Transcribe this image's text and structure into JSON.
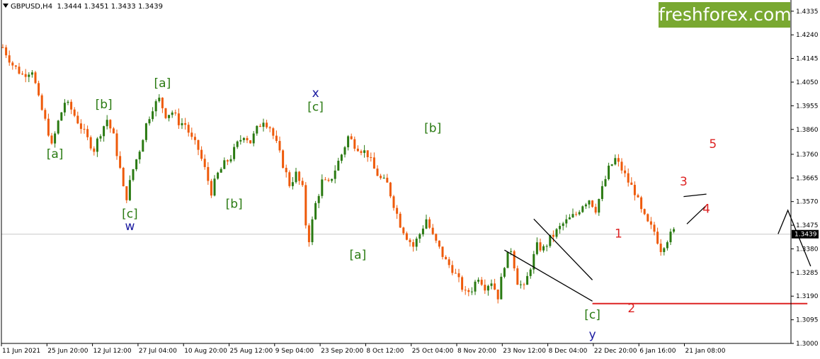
{
  "header": {
    "symbol": "GBPUSD,H4",
    "ohlc": "1.3444 1.3451 1.3433 1.3439"
  },
  "brand": {
    "logo_text": "freshforex.com"
  },
  "colors": {
    "bull": "#2a7a12",
    "bear": "#ee5a0a",
    "green_label": "#2a7a12",
    "blue_label": "#1a1aa0",
    "red_label": "#dd2222",
    "red_line": "#dd2222",
    "price_line": "#c8c8c8"
  },
  "chart_data": {
    "type": "candlestick",
    "ylim": [
      1.3,
      1.438
    ],
    "y_ticks": [
      "1.4335",
      "1.4240",
      "1.4145",
      "1.4050",
      "1.3955",
      "1.3860",
      "1.3760",
      "1.3665",
      "1.3570",
      "1.3475",
      "1.3380",
      "1.3285",
      "1.3190",
      "1.3095",
      "1.3000"
    ],
    "x_ticks": [
      "11 Jun 2021",
      "25 Jun 20:00",
      "12 Jul 12:00",
      "27 Jul 04:00",
      "10 Aug 20:00",
      "25 Aug 12:00",
      "9 Sep 04:00",
      "23 Sep 20:00",
      "8 Oct 12:00",
      "25 Oct 04:00",
      "8 Nov 20:00",
      "23 Nov 12:00",
      "8 Dec 04:00",
      "22 Dec 20:00",
      "6 Jan 16:00",
      "21 Jan 08:00"
    ],
    "current_price": "1.3439",
    "price_path": [
      [
        0,
        1.419
      ],
      [
        3,
        1.412
      ],
      [
        6,
        1.408
      ],
      [
        9,
        1.41
      ],
      [
        11,
        1.398
      ],
      [
        14,
        1.385
      ],
      [
        15,
        1.379
      ],
      [
        17,
        1.389
      ],
      [
        19,
        1.397
      ],
      [
        21,
        1.394
      ],
      [
        24,
        1.387
      ],
      [
        26,
        1.382
      ],
      [
        28,
        1.378
      ],
      [
        30,
        1.385
      ],
      [
        32,
        1.39
      ],
      [
        34,
        1.383
      ],
      [
        36,
        1.37
      ],
      [
        37,
        1.362
      ],
      [
        38,
        1.359
      ],
      [
        40,
        1.37
      ],
      [
        42,
        1.378
      ],
      [
        44,
        1.388
      ],
      [
        46,
        1.395
      ],
      [
        48,
        1.398
      ],
      [
        50,
        1.392
      ],
      [
        52,
        1.393
      ],
      [
        54,
        1.389
      ],
      [
        56,
        1.388
      ],
      [
        58,
        1.382
      ],
      [
        60,
        1.378
      ],
      [
        62,
        1.37
      ],
      [
        64,
        1.361
      ],
      [
        66,
        1.368
      ],
      [
        68,
        1.372
      ],
      [
        70,
        1.375
      ],
      [
        72,
        1.38
      ],
      [
        74,
        1.384
      ],
      [
        76,
        1.381
      ],
      [
        78,
        1.386
      ],
      [
        80,
        1.39
      ],
      [
        82,
        1.387
      ],
      [
        84,
        1.38
      ],
      [
        86,
        1.372
      ],
      [
        88,
        1.364
      ],
      [
        90,
        1.368
      ],
      [
        92,
        1.362
      ],
      [
        93,
        1.348
      ],
      [
        94,
        1.342
      ],
      [
        96,
        1.356
      ],
      [
        98,
        1.365
      ],
      [
        100,
        1.364
      ],
      [
        102,
        1.37
      ],
      [
        104,
        1.376
      ],
      [
        106,
        1.383
      ],
      [
        108,
        1.38
      ],
      [
        110,
        1.378
      ],
      [
        112,
        1.376
      ],
      [
        114,
        1.37
      ],
      [
        116,
        1.366
      ],
      [
        118,
        1.364
      ],
      [
        120,
        1.356
      ],
      [
        122,
        1.348
      ],
      [
        124,
        1.343
      ],
      [
        126,
        1.339
      ],
      [
        128,
        1.344
      ],
      [
        130,
        1.35
      ],
      [
        132,
        1.343
      ],
      [
        134,
        1.338
      ],
      [
        136,
        1.333
      ],
      [
        138,
        1.33
      ],
      [
        140,
        1.325
      ],
      [
        142,
        1.32
      ],
      [
        144,
        1.322
      ],
      [
        146,
        1.327
      ],
      [
        148,
        1.323
      ],
      [
        150,
        1.325
      ],
      [
        152,
        1.319
      ],
      [
        154,
        1.332
      ],
      [
        156,
        1.338
      ],
      [
        158,
        1.325
      ],
      [
        160,
        1.322
      ],
      [
        162,
        1.331
      ],
      [
        164,
        1.339
      ],
      [
        166,
        1.338
      ],
      [
        168,
        1.342
      ],
      [
        170,
        1.345
      ],
      [
        172,
        1.348
      ],
      [
        174,
        1.35
      ],
      [
        176,
        1.352
      ],
      [
        178,
        1.356
      ],
      [
        180,
        1.358
      ],
      [
        182,
        1.354
      ],
      [
        184,
        1.362
      ],
      [
        186,
        1.37
      ],
      [
        188,
        1.374
      ],
      [
        190,
        1.37
      ],
      [
        192,
        1.365
      ],
      [
        194,
        1.361
      ],
      [
        196,
        1.353
      ],
      [
        198,
        1.348
      ],
      [
        200,
        1.345
      ],
      [
        202,
        1.338
      ],
      [
        204,
        1.342
      ],
      [
        206,
        1.345
      ]
    ],
    "n_candles": 207,
    "annotations": [
      {
        "text": "[a]",
        "x": 16,
        "y": 1.3745,
        "color": "green"
      },
      {
        "text": "[b]",
        "x": 31,
        "y": 1.3945,
        "color": "green"
      },
      {
        "text": "[c]",
        "x": 39,
        "y": 1.3505,
        "color": "green"
      },
      {
        "text": "w",
        "x": 39,
        "y": 1.3455,
        "color": "blue"
      },
      {
        "text": "[a]",
        "x": 49,
        "y": 1.403,
        "color": "green"
      },
      {
        "text": "[b]",
        "x": 71,
        "y": 1.3545,
        "color": "green"
      },
      {
        "text": "x",
        "x": 96,
        "y": 1.399,
        "color": "blue"
      },
      {
        "text": "[c]",
        "x": 96,
        "y": 1.3935,
        "color": "green"
      },
      {
        "text": "[a]",
        "x": 109,
        "y": 1.334,
        "color": "green"
      },
      {
        "text": "[b]",
        "x": 132,
        "y": 1.385,
        "color": "green"
      },
      {
        "text": "[c]",
        "x": 181,
        "y": 1.31,
        "color": "green"
      },
      {
        "text": "y",
        "x": 181,
        "y": 1.302,
        "color": "blue"
      },
      {
        "text": "1",
        "x": 189,
        "y": 1.3425,
        "color": "red"
      },
      {
        "text": "2",
        "x": 193,
        "y": 1.3125,
        "color": "red"
      },
      {
        "text": "3",
        "x": 209,
        "y": 1.3635,
        "color": "red"
      },
      {
        "text": "4",
        "x": 216,
        "y": 1.3525,
        "color": "red"
      },
      {
        "text": "5",
        "x": 218,
        "y": 1.3785,
        "color": "red"
      }
    ],
    "trendlines": [
      {
        "from": [
          154,
          1.3375
        ],
        "to": [
          181,
          1.317
        ],
        "color": "#000000"
      },
      {
        "from": [
          163,
          1.35
        ],
        "to": [
          181,
          1.3255
        ],
        "color": "#000000"
      },
      {
        "from": [
          209,
          1.359
        ],
        "to": [
          216,
          1.36
        ],
        "color": "#000000"
      },
      {
        "from": [
          210,
          1.348
        ],
        "to": [
          216,
          1.3555
        ],
        "color": "#000000"
      },
      {
        "from": [
          181,
          1.316
        ],
        "to": [
          247,
          1.316
        ],
        "color": "#dd2222"
      }
    ],
    "forecast_path": [
      [
        238,
        1.344
      ],
      [
        241,
        1.3535
      ],
      [
        248,
        1.331
      ]
    ]
  }
}
